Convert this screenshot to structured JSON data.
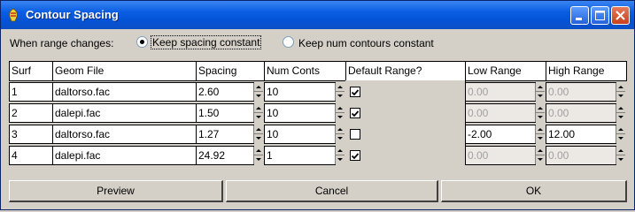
{
  "window": {
    "title": "Contour Spacing",
    "controls": [
      "minimize",
      "maximize",
      "close"
    ]
  },
  "range_change": {
    "label": "When range changes:",
    "options": [
      {
        "label": "Keep spacing constant",
        "selected": true
      },
      {
        "label": "Keep num contours constant",
        "selected": false
      }
    ]
  },
  "table": {
    "headers": [
      "Surf",
      "Geom File",
      "Spacing",
      "Num Conts",
      "Default Range?",
      "Low Range",
      "High Range"
    ],
    "rows": [
      {
        "surf": "1",
        "geom": "daltorso.fac",
        "spacing": "2.60",
        "num": "10",
        "default": true,
        "low": "0.00",
        "high": "0.00"
      },
      {
        "surf": "2",
        "geom": "dalepi.fac",
        "spacing": "1.50",
        "num": "10",
        "default": true,
        "low": "0.00",
        "high": "0.00"
      },
      {
        "surf": "3",
        "geom": "daltorso.fac",
        "spacing": "1.27",
        "num": "10",
        "default": false,
        "low": "-2.00",
        "high": "12.00"
      },
      {
        "surf": "4",
        "geom": "dalepi.fac",
        "spacing": "24.92",
        "num": "1",
        "default": true,
        "low": "0.00",
        "high": "0.00"
      }
    ]
  },
  "buttons": {
    "preview": "Preview",
    "cancel": "Cancel",
    "ok": "OK"
  },
  "icons": {
    "app": "app-icon",
    "check": "check-icon"
  }
}
